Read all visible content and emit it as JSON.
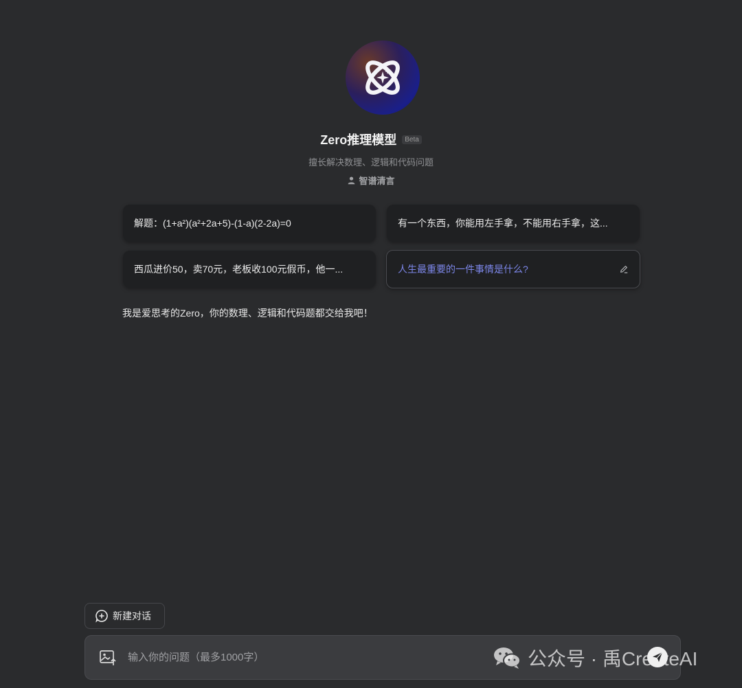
{
  "app": {
    "title": "Zero推理模型",
    "badge": "Beta",
    "subtitle": "擅长解决数理、逻辑和代码问题",
    "author": "智谱清言",
    "avatar_icon": "atom-sparkle-icon"
  },
  "suggestions": [
    {
      "text": "解题：(1+a²)(a²+2a+5)-(1-a)(2-2a)=0"
    },
    {
      "text": "有一个东西，你能用左手拿，不能用右手拿，这..."
    },
    {
      "text": "西瓜进价50，卖70元，老板收100元假币，他一..."
    },
    {
      "text": "人生最重要的一件事情是什么?",
      "icon": "edit-icon"
    }
  ],
  "intro_message": "我是爱思考的Zero，你的数理、逻辑和代码题都交给我吧！",
  "new_chat": {
    "label": "新建对话",
    "icon": "add-chat-icon"
  },
  "input": {
    "placeholder": "输入你的问题（最多1000字）",
    "upload_icon": "image-upload-icon",
    "send_icon": "send-icon"
  },
  "watermark": {
    "text": "公众号 · 禹CreateAI",
    "icon": "wechat-icon"
  },
  "colors": {
    "background": "#2a2b2d",
    "card": "#1f2022",
    "accent": "#7c86e8"
  }
}
